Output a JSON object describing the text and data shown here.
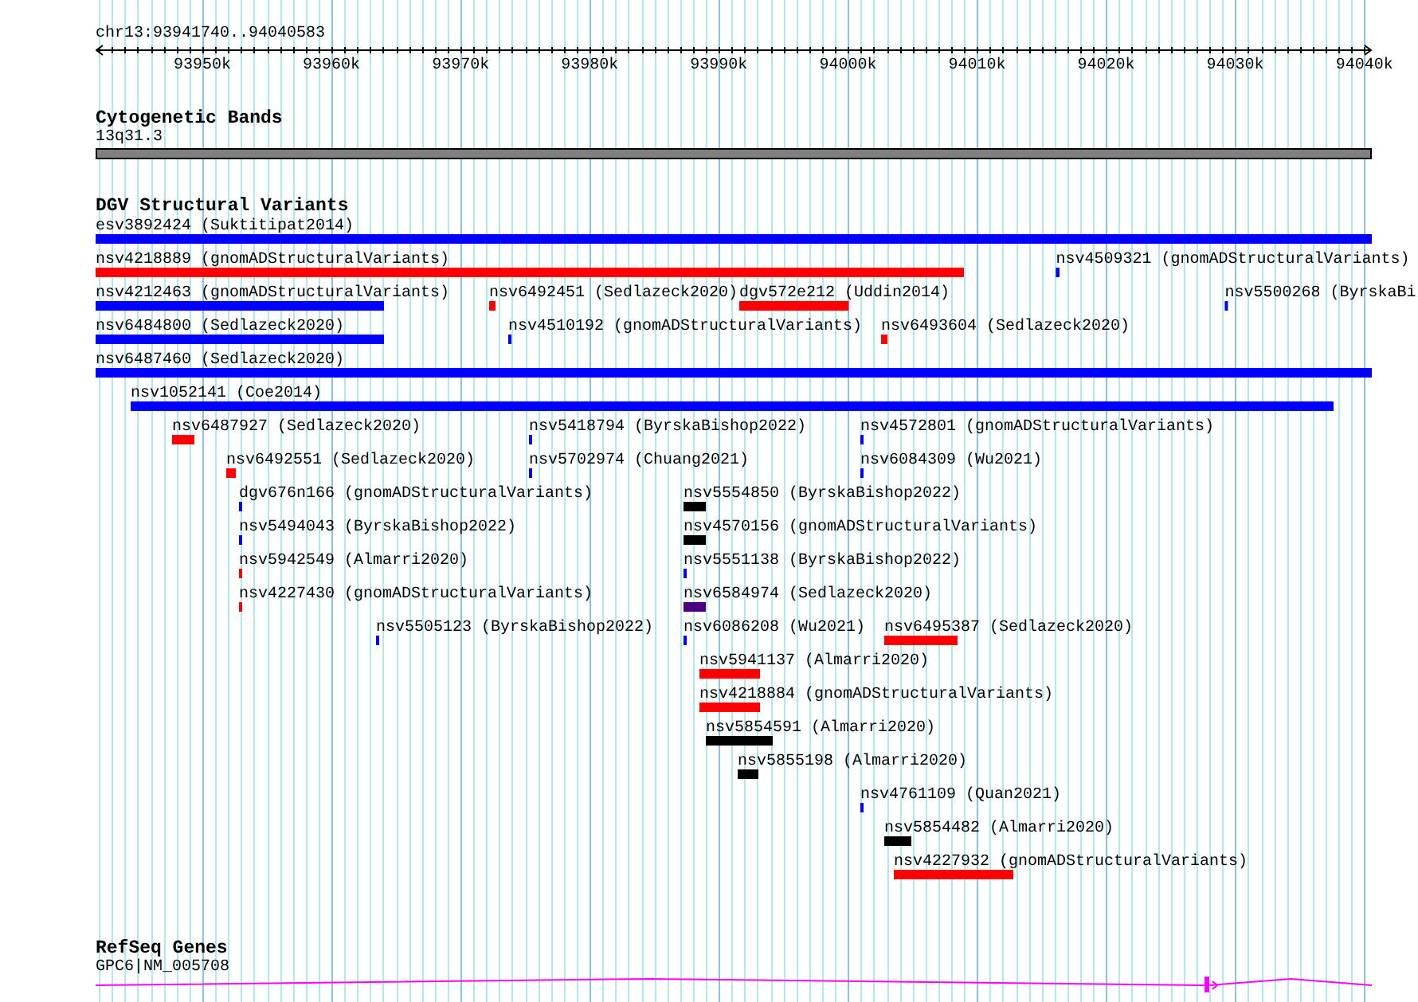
{
  "ruler": {
    "location": "chr13:93941740..94040583",
    "ticks": [
      "93950k",
      "93960k",
      "93970k",
      "93980k",
      "93990k",
      "94000k",
      "94010k",
      "94020k",
      "94030k",
      "94040k"
    ]
  },
  "cytogenetic_bands": {
    "title": "Cytogenetic Bands",
    "band": {
      "label": "13q31.3"
    }
  },
  "dgv_structural_variants": {
    "title": "DGV Structural Variants",
    "rows": [
      {
        "features": [
          {
            "label": "esv3892424 (Suktitipat2014)",
            "color": "#0000ff"
          }
        ]
      },
      {
        "features": [
          {
            "label": "nsv4218889 (gnomADStructuralVariants)",
            "color": "#ff0000"
          },
          {
            "label": "nsv4509321 (gnomADStructuralVariants)",
            "color": "#0000ff"
          }
        ]
      },
      {
        "features": [
          {
            "label": "nsv4212463 (gnomADStructuralVariants)",
            "color": "#0000ff"
          },
          {
            "label": "nsv6492451 (Sedlazeck2020)",
            "color": "#ff0000"
          },
          {
            "label": "dgv572e212 (Uddin2014)",
            "color": "#ff0000"
          },
          {
            "label": "nsv5500268 (ByrskaBi",
            "color": "#0000ff"
          }
        ]
      },
      {
        "features": [
          {
            "label": "nsv6484800 (Sedlazeck2020)",
            "color": "#0000ff"
          },
          {
            "label": "nsv4510192 (gnomADStructuralVariants)",
            "color": "#0000ff"
          },
          {
            "label": "nsv6493604 (Sedlazeck2020)",
            "color": "#ff0000"
          }
        ]
      },
      {
        "features": [
          {
            "label": "nsv6487460 (Sedlazeck2020)",
            "color": "#0000ff"
          }
        ]
      },
      {
        "features": [
          {
            "label": "nsv1052141 (Coe2014)",
            "color": "#0000ff"
          }
        ]
      },
      {
        "features": [
          {
            "label": "nsv6487927 (Sedlazeck2020)",
            "color": "#ff0000"
          },
          {
            "label": "nsv5418794 (ByrskaBishop2022)",
            "color": "#0000ff"
          },
          {
            "label": "nsv4572801 (gnomADStructuralVariants)",
            "color": "#0000ff"
          }
        ]
      },
      {
        "features": [
          {
            "label": "nsv6492551 (Sedlazeck2020)",
            "color": "#ff0000"
          },
          {
            "label": "nsv5702974 (Chuang2021)",
            "color": "#0000ff"
          },
          {
            "label": "nsv6084309 (Wu2021)",
            "color": "#0000ff"
          }
        ]
      },
      {
        "features": [
          {
            "label": "dgv676n166 (gnomADStructuralVariants)",
            "color": "#0000ff"
          },
          {
            "label": "nsv5554850 (ByrskaBishop2022)",
            "color": "#000000"
          }
        ]
      },
      {
        "features": [
          {
            "label": "nsv5494043 (ByrskaBishop2022)",
            "color": "#0000ff"
          },
          {
            "label": "nsv4570156 (gnomADStructuralVariants)",
            "color": "#000000"
          }
        ]
      },
      {
        "features": [
          {
            "label": "nsv5942549 (Almarri2020)",
            "color": "#ff0000"
          },
          {
            "label": "nsv5551138 (ByrskaBishop2022)",
            "color": "#0000ff"
          }
        ]
      },
      {
        "features": [
          {
            "label": "nsv4227430 (gnomADStructuralVariants)",
            "color": "#ff0000"
          },
          {
            "label": "nsv6584974 (Sedlazeck2020)",
            "color": "#4b0082"
          }
        ]
      },
      {
        "features": [
          {
            "label": "nsv5505123 (ByrskaBishop2022)",
            "color": "#0000ff"
          },
          {
            "label": "nsv6086208 (Wu2021)",
            "color": "#0000ff"
          },
          {
            "label": "nsv6495387 (Sedlazeck2020)",
            "color": "#ff0000"
          }
        ]
      },
      {
        "features": [
          {
            "label": "nsv5941137 (Almarri2020)",
            "color": "#ff0000"
          }
        ]
      },
      {
        "features": [
          {
            "label": "nsv4218884 (gnomADStructuralVariants)",
            "color": "#ff0000"
          }
        ]
      },
      {
        "features": [
          {
            "label": "nsv5854591 (Almarri2020)",
            "color": "#000000"
          }
        ]
      },
      {
        "features": [
          {
            "label": "nsv5855198 (Almarri2020)",
            "color": "#000000"
          }
        ]
      },
      {
        "features": [
          {
            "label": "nsv4761109 (Quan2021)",
            "color": "#0000ff"
          }
        ]
      },
      {
        "features": [
          {
            "label": "nsv5854482 (Almarri2020)",
            "color": "#000000"
          }
        ]
      },
      {
        "features": [
          {
            "label": "nsv4227932 (gnomADStructuralVariants)",
            "color": "#ff0000"
          }
        ]
      }
    ]
  },
  "refseq_genes": {
    "title": "RefSeq Genes",
    "genes": [
      {
        "label": "GPC6|NM_005708",
        "forward_strand": true
      }
    ]
  }
}
